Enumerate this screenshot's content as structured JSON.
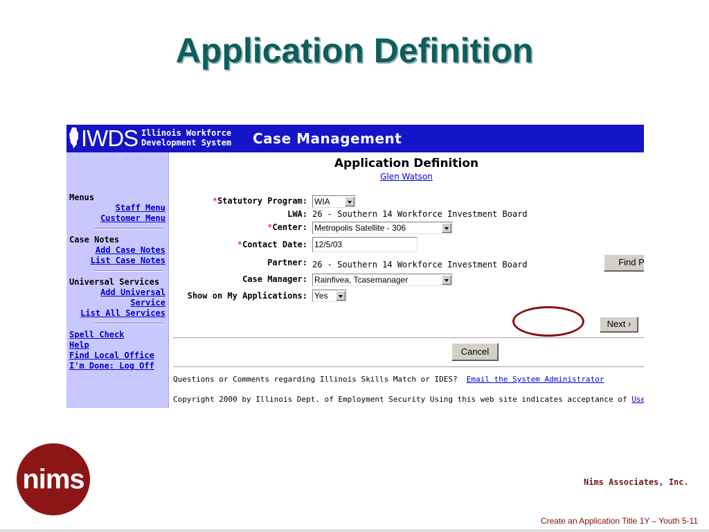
{
  "slide": {
    "title": "Application Definition",
    "company": "Nims Associates, Inc.",
    "footer": "Create an Application Title 1Y – Youth  5-11",
    "logo_text": "nims"
  },
  "banner": {
    "logo": "IWDS",
    "subtitle": "Illinois Workforce\nDevelopment System",
    "title": "Case Management"
  },
  "sidebar": {
    "menus_heading": "Menus",
    "staff_menu": "Staff Menu",
    "customer_menu": "Customer Menu",
    "case_notes_heading": "Case Notes",
    "add_case_notes": "Add Case Notes",
    "list_case_notes": "List Case Notes",
    "universal_services_heading": "Universal Services",
    "add_universal_service_1": "Add Universal",
    "add_universal_service_2": "Service",
    "list_all_services": "List All Services",
    "spell_check": "Spell Check",
    "help": "Help",
    "find_local_office": "Find Local Office",
    "log_off": "I'm Done: Log Off"
  },
  "form": {
    "heading": "Application Definition",
    "customer": "Glen Watson",
    "statutory_program_label": "Statutory Program:",
    "statutory_program_value": "WIA",
    "lwa_label": "LWA:",
    "lwa_value": "26 - Southern 14 Workforce Investment Board",
    "center_label": "Center:",
    "center_value": "Metropolis Satellite - 306",
    "contact_date_label": "Contact Date:",
    "contact_date_value": "12/5/03",
    "partner_label": "Partner:",
    "partner_value": "26 - Southern 14 Workforce Investment Board",
    "find_partner": "Find Partner",
    "case_manager_label": "Case Manager:",
    "case_manager_value": "Rainfivea, Tcasemanager",
    "show_label": "Show on My Applications:",
    "show_value": "Yes",
    "next": "Next",
    "cancel": "Cancel",
    "required_mark": "*"
  },
  "footer": {
    "question": "Questions or Comments regarding Illinois Skills Match or IDES?",
    "email_link": "Email the System Administrator",
    "copyright": "Copyright 2000 by Illinois Dept. of Employment Security Using this web site indicates acceptance of",
    "user_link": "User"
  },
  "colors": {
    "banner": "#1414c8",
    "sidebar": "#c8c8ff",
    "title": "#0e5e5e",
    "highlight_circle": "#8a1010"
  }
}
